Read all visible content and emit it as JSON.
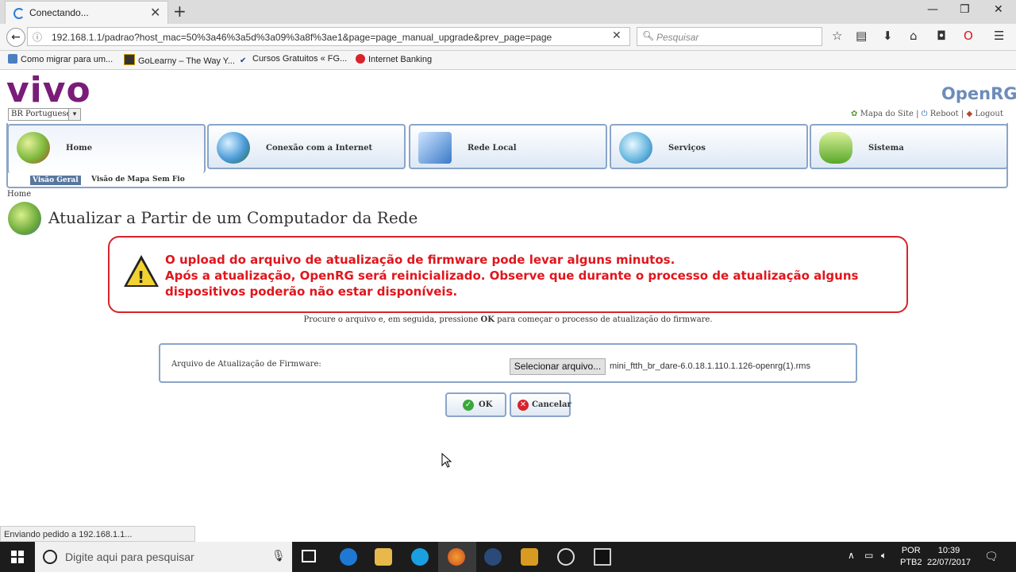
{
  "browser": {
    "tab_title": "Conectando...",
    "url": "192.168.1.1/padrao?host_mac=50%3a46%3a5d%3a09%3a8f%3ae1&page=page_manual_upgrade&prev_page=page",
    "search_placeholder": "Pesquisar",
    "bookmarks": [
      {
        "label": "Como migrar para um...",
        "icon": "bookmark-icon"
      },
      {
        "label": "GoLearny – The Way Y...",
        "icon": "golearny-icon"
      },
      {
        "label": "Cursos Gratuitos « FG...",
        "icon": "fgv-icon"
      },
      {
        "label": "Internet Banking",
        "icon": "bank-icon"
      }
    ],
    "status_text": "Enviando pedido a 192.168.1.1..."
  },
  "header": {
    "logo": "vivo",
    "brand": "OpenRG",
    "language": "BR Portuguese",
    "links": {
      "sitemap": "Mapa do Site",
      "reboot": "Reboot",
      "logout": "Logout",
      "sep": "|"
    }
  },
  "nav": {
    "tabs": [
      {
        "label": "Home"
      },
      {
        "label": "Conexão com a Internet"
      },
      {
        "label": "Rede Local"
      },
      {
        "label": "Serviços"
      },
      {
        "label": "Sistema"
      }
    ],
    "subtabs": [
      {
        "label": "Visão Geral"
      },
      {
        "label": "Visão de Mapa"
      },
      {
        "label": "Sem Fio"
      }
    ]
  },
  "page": {
    "breadcrumb": "Home",
    "title": "Atualizar a Partir de um Computador da Rede",
    "alert_line1": "O upload do arquivo de atualização de firmware pode levar alguns minutos.",
    "alert_line2": "Após a atualização, OpenRG será reinicializado. Observe que durante o processo de atualização alguns dispositivos poderão não estar disponíveis.",
    "instr_before": "Procure o arquivo e, em seguida, pressione ",
    "instr_ok": "OK",
    "instr_after": " para começar o processo de atualização do firmware.",
    "form_label": "Arquivo de Atualização de Firmware:",
    "file_button": "Selecionar arquivo...",
    "file_name": "mini_ftth_br_dare-6.0.18.1.110.1.126-openrg(1).rms",
    "ok_label": "OK",
    "cancel_label": "Cancelar"
  },
  "taskbar": {
    "search_placeholder": "Digite aqui para pesquisar",
    "lang_top": "POR",
    "lang_bottom": "PTB2",
    "time": "10:39",
    "date": "22/07/2017"
  },
  "colors": {
    "vivo_purple": "#7a1c7a",
    "alert_red": "#e0161c",
    "nav_border": "#8aa5c8"
  }
}
